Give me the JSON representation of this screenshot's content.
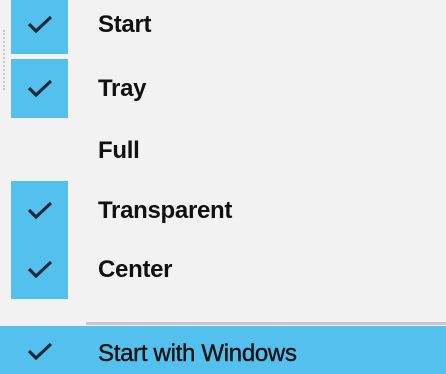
{
  "menu": {
    "items": [
      {
        "label": "Start",
        "checked": true,
        "icon": "checkmark-icon"
      },
      {
        "label": "Tray",
        "checked": true,
        "icon": "checkmark-icon"
      },
      {
        "label": "Full",
        "checked": false,
        "icon": ""
      },
      {
        "label": "Transparent",
        "checked": true,
        "icon": "checkmark-icon"
      },
      {
        "label": "Center",
        "checked": true,
        "icon": "checkmark-icon"
      }
    ],
    "footer_item": {
      "label": "Start with Windows",
      "checked": true,
      "highlighted": true,
      "icon": "checkmark-icon"
    }
  },
  "colors": {
    "menu_background": "#f2f2f2",
    "check_highlight": "#54c0ee",
    "text": "#111111",
    "separator": "#c9c9c9",
    "checkmark": "#1b2a3a"
  }
}
